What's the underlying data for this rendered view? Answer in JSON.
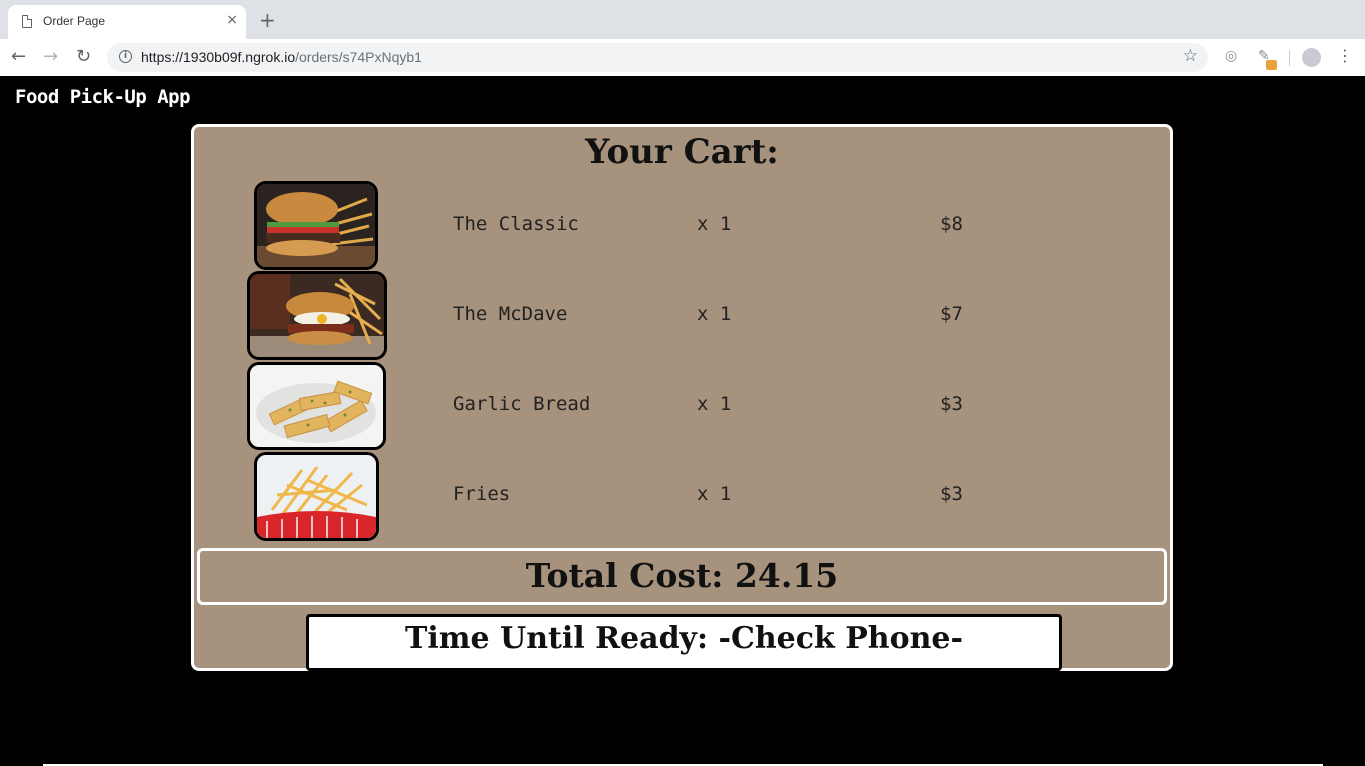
{
  "browser": {
    "tab_title": "Order Page",
    "tab_close": "×",
    "new_tab": "+",
    "url_host": "https://1930b09f.ngrok.io",
    "url_path": "/orders/s74PxNqyb1",
    "back_icon": "←",
    "forward_icon": "→",
    "reload_icon": "↻",
    "star_icon": "☆",
    "menu_icon": "⋮"
  },
  "app": {
    "title": "Food Pick-Up App"
  },
  "cart": {
    "title": "Your Cart:",
    "items": [
      {
        "name": "The Classic",
        "qty": "x 1",
        "price": "$8"
      },
      {
        "name": "The McDave",
        "qty": "x 1",
        "price": "$7"
      },
      {
        "name": "Garlic Bread",
        "qty": "x 1",
        "price": "$3"
      },
      {
        "name": "Fries",
        "qty": "x 1",
        "price": "$3"
      }
    ],
    "total": "Total Cost: 24.15",
    "ready": "Time Until Ready: -Check Phone-"
  },
  "colors": {
    "page_background": "#000000",
    "cart_background": "#a6927d",
    "border": "#ffffff"
  }
}
